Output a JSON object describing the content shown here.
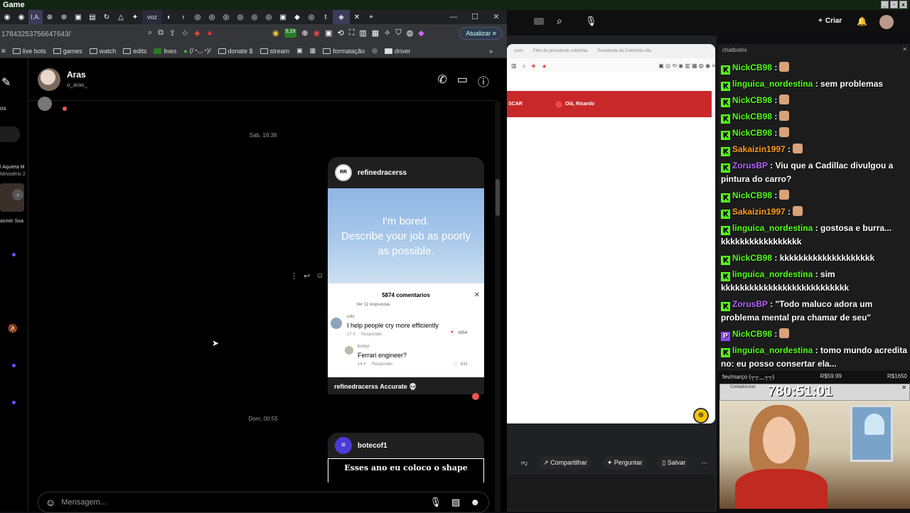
{
  "window": {
    "title": "Game"
  },
  "browser_left": {
    "tabs": [
      "I.A.",
      "voz",
      "r"
    ],
    "url": "17843253756647643/",
    "update_label": "Atualizar",
    "bookmarks": [
      "live bots",
      "games",
      "watch",
      "edits",
      "lives",
      "(/◔◡◔)/",
      "donate $",
      "stream",
      "formatação",
      "driver"
    ],
    "extension_badge": "5,19"
  },
  "instagram": {
    "contact_name": "Aras",
    "contact_username": "o_aras_",
    "left_labels": [
      "os",
      "l Aquieta M",
      "Ministério 2",
      "asmin Soa"
    ],
    "timestamp_1": "Sáb, 18:38",
    "post1": {
      "author": "refinedracerss",
      "image_text_line1": "I'm bored.",
      "image_text_line2": "Describe your job as poorly",
      "image_text_line3": "as possible.",
      "comments_header": "5874 comentarios",
      "see_replies": "Ver 11 respuestas",
      "comment1_user": "julie",
      "comment1_text": "I help people cry more efficiently",
      "comment1_time": "17 h",
      "comment1_reply": "Responder",
      "comment1_likes": "4954",
      "comment2_user": "borkyr",
      "comment2_text": "Ferrari engineer?",
      "comment2_time": "14 h",
      "comment2_reply": "Responder",
      "comment2_likes": "831",
      "caption": "refinedracerss Accurate 💀"
    },
    "timestamp_2": "Dom, 00:55",
    "post2": {
      "author": "botecof1",
      "image_text": "Esses ano eu coloco o shape"
    },
    "message_placeholder": "Mensagem..."
  },
  "browser_mid": {
    "tabs": [
      "Filho do presidente colombia",
      "Presidente da Colômbia não"
    ],
    "red_bar_left": "SCAR",
    "red_bar_greeting": "Olá, Ricardo",
    "bottom_actions": [
      "Compartilhar",
      "Perguntar",
      "Salvar"
    ]
  },
  "top_right": {
    "create_label": "Criar"
  },
  "chat": {
    "title": "chatbotrix",
    "messages": [
      {
        "user": "NickCB98",
        "text": ":",
        "color": "#53fc18",
        "badge": "K"
      },
      {
        "user": "linguica_nordestina",
        "text": ": sem problemas",
        "color": "#53fc18",
        "badge": "K"
      },
      {
        "user": "NickCB98",
        "text": ":",
        "color": "#53fc18",
        "badge": "K"
      },
      {
        "user": "NickCB98",
        "text": ":",
        "color": "#53fc18",
        "badge": "K"
      },
      {
        "user": "NickCB98",
        "text": ":",
        "color": "#53fc18",
        "badge": "K"
      },
      {
        "user": "Sakaizin1997",
        "text": ":",
        "color": "#ff9f1a",
        "badge": "K"
      },
      {
        "user": "ZorusBP",
        "text": ": Viu que a Cadillac divulgou a pintura do carro?",
        "color": "#b462ff",
        "badge": "K"
      },
      {
        "user": "NickCB98",
        "text": ":",
        "color": "#53fc18",
        "badge": "K"
      },
      {
        "user": "Sakaizin1997",
        "text": ":",
        "color": "#ff9f1a",
        "badge": "K"
      },
      {
        "user": "linguica_nordestina",
        "text": ": gostosa e burra... kkkkkkkkkkkkkkkkk",
        "color": "#53fc18",
        "badge": "K"
      },
      {
        "user": "NickCB98",
        "text": ": kkkkkkkkkkkkkkkkkkkk",
        "color": "#53fc18",
        "badge": "K"
      },
      {
        "user": "linguica_nordestina",
        "text": ": sim kkkkkkkkkkkkkkkkkkkkkkkkkkk",
        "color": "#53fc18",
        "badge": "K"
      },
      {
        "user": "ZorusBP",
        "text": ": \"Todo maluco adora um problema mental pra chamar de seu\"",
        "color": "#b462ff",
        "badge": "K"
      },
      {
        "user": "NickCB98",
        "text": ":",
        "color": "#53fc18",
        "badge": "P"
      },
      {
        "user": "linguica_nordestina",
        "text": ": tomo mundo acredita no: eu posso consertar ela...",
        "color": "#53fc18",
        "badge": "K"
      }
    ]
  },
  "overlay": {
    "goal_label": "fev/março (┬┬﹏┬┬)",
    "goal_current": "R$59.99",
    "goal_target": "R$1650",
    "timer": "780:51:01",
    "timer_window_title": "Contador.exe"
  }
}
